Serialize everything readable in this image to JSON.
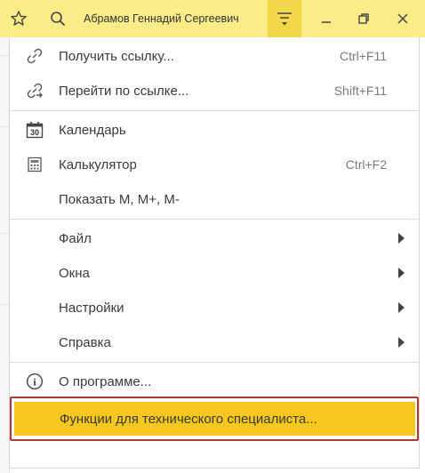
{
  "titlebar": {
    "user_name": "Абрамов Геннадий Сергеевич",
    "icons": [
      "star-icon",
      "search-icon",
      "main-menu-icon",
      "minimize-icon",
      "restore-icon",
      "close-icon"
    ]
  },
  "menu": {
    "items": [
      {
        "label": "Получить ссылку...",
        "shortcut": "Ctrl+F11",
        "icon": "link-icon"
      },
      {
        "label": "Перейти по ссылке...",
        "shortcut": "Shift+F11",
        "icon": "follow-link-icon"
      },
      {
        "label": "Календарь",
        "shortcut": "",
        "icon": "calendar-icon",
        "icon_text": "30"
      },
      {
        "label": "Калькулятор",
        "shortcut": "Ctrl+F2",
        "icon": "calculator-icon"
      },
      {
        "label": "Показать M, M+, M-",
        "shortcut": ""
      },
      {
        "label": "Файл",
        "submenu": true
      },
      {
        "label": "Окна",
        "submenu": true
      },
      {
        "label": "Настройки",
        "submenu": true
      },
      {
        "label": "Справка",
        "submenu": true
      },
      {
        "label": "О программе...",
        "icon": "info-icon",
        "icon_text": "i"
      },
      {
        "label": "Функции для технического специалиста...",
        "highlighted": true
      }
    ]
  },
  "colors": {
    "titlebar_bg": "#fbec88",
    "menu_button_bg": "#f2d848",
    "highlight_bg": "#f6c81e",
    "highlight_frame": "#b03a3a"
  }
}
